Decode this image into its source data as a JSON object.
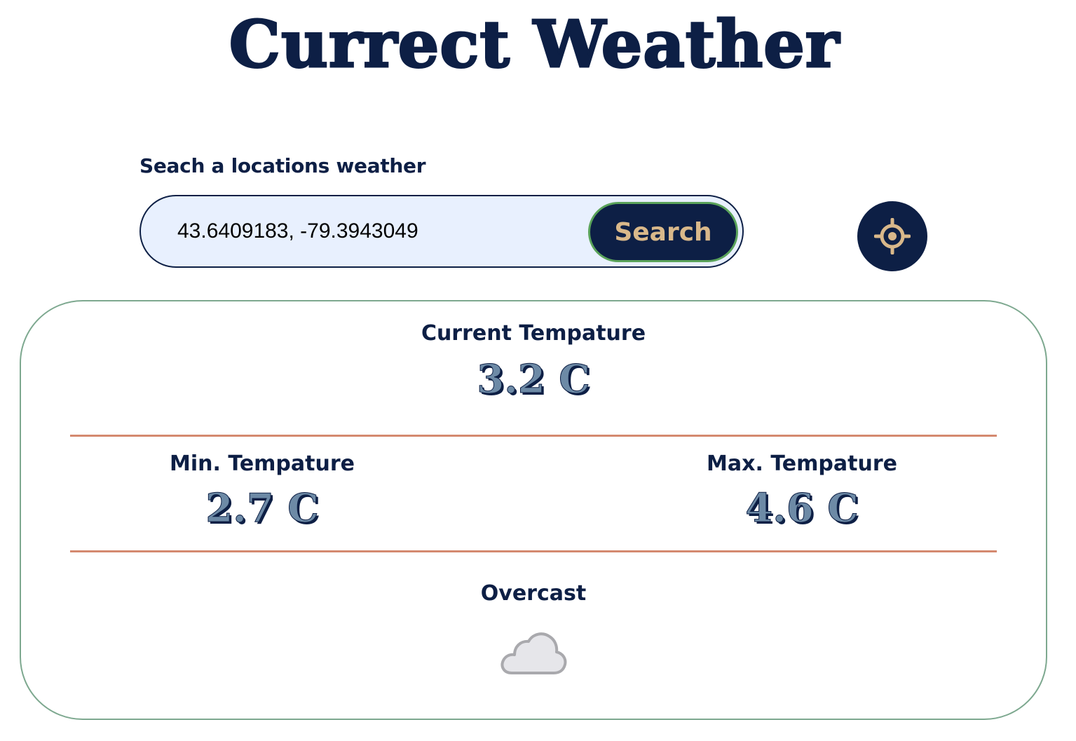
{
  "app": {
    "title": "Currect Weather"
  },
  "search": {
    "label": "Seach a locations weather",
    "value": "43.6409183, -79.3943049",
    "button_label": "Search"
  },
  "locate_button": {
    "icon": "crosshair-icon"
  },
  "weather": {
    "current_label": "Current Tempature",
    "current_value": "3.2 C",
    "min_label": "Min. Tempature",
    "min_value": "2.7 C",
    "max_label": "Max. Tempature",
    "max_value": "4.6 C",
    "condition": "Overcast",
    "condition_icon": "cloud-icon"
  },
  "colors": {
    "navy": "#0d1f45",
    "accent_gold": "#d9b88a",
    "divider": "#d4896f",
    "card_border": "#7da88f",
    "input_background": "#e8f0fe",
    "value_fill": "#6d8aa6"
  }
}
